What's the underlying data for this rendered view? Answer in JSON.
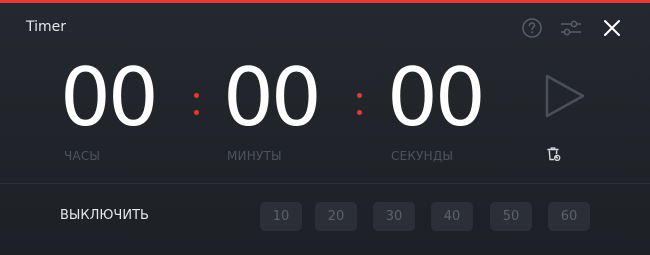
{
  "window": {
    "title": "Timer",
    "accent_color": "#e53935",
    "background_color": "#23262b"
  },
  "header": {
    "icons": [
      "help-icon",
      "settings-sliders-icon",
      "close-icon"
    ]
  },
  "time": {
    "hours": "00",
    "minutes": "00",
    "seconds": "00"
  },
  "labels": {
    "hours": "ЧАСЫ",
    "minutes": "МИНУТЫ",
    "seconds": "СЕКУНДЫ"
  },
  "controls": {
    "play_icon": "play-icon",
    "reset_icon": "reset-trash-icon"
  },
  "shutdown": {
    "label": "ВЫКЛЮЧИТЬ",
    "presets": [
      "10",
      "20",
      "30",
      "40",
      "50",
      "60"
    ]
  }
}
